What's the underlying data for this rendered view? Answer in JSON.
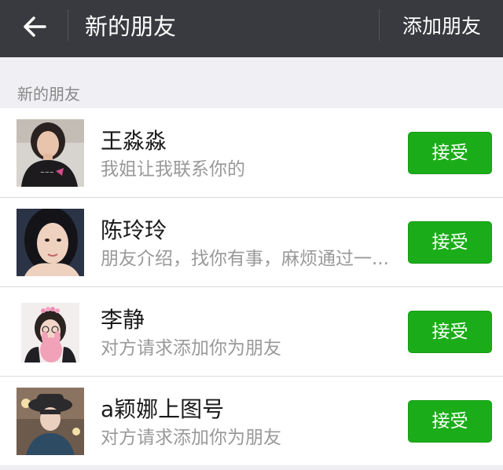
{
  "header": {
    "title": "新的朋友",
    "action_label": "添加朋友"
  },
  "section": {
    "label": "新的朋友"
  },
  "requests": [
    {
      "name": "王淼淼",
      "message": "我姐让我联系你的",
      "button": "接受"
    },
    {
      "name": "陈玲玲",
      "message": "朋友介绍，找你有事，麻烦通过一...",
      "button": "接受"
    },
    {
      "name": "李静",
      "message": "对方请求添加你为朋友",
      "button": "接受"
    },
    {
      "name": "a颖娜上图号",
      "message": "对方请求添加你为朋友",
      "button": "接受"
    }
  ],
  "colors": {
    "topbar": "#393a3f",
    "accept_green": "#1aad19",
    "background": "#efeff4",
    "secondary_text": "#999999"
  },
  "icons": {
    "back": "arrow-left-icon"
  }
}
